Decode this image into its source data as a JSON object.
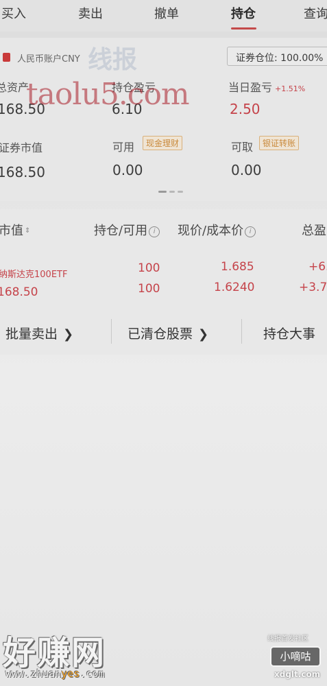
{
  "tabs": [
    {
      "label": "买入"
    },
    {
      "label": "卖出"
    },
    {
      "label": "撤单"
    },
    {
      "label": "持仓"
    },
    {
      "label": "查询"
    }
  ],
  "active_tab": "持仓",
  "account": {
    "label": "人民币账户CNY",
    "position_ratio": "证券仓位: 100.00%"
  },
  "summary": {
    "total_assets_label": "总资产",
    "total_assets_value": "168.50",
    "holding_pnl_label": "持仓盈亏",
    "holding_pnl_value": "6.10",
    "daily_pnl_label": "当日盈亏",
    "daily_pnl_pct": "+1.51%",
    "daily_pnl_value": "2.50",
    "market_value_label": "证券市值",
    "market_value_value": "168.50",
    "available_label": "可用",
    "available_pill": "现金理财",
    "available_value": "0.00",
    "withdrawable_label": "可取",
    "withdrawable_pill": "银证转账",
    "withdrawable_value": "0.00"
  },
  "holdings": {
    "columns": [
      "市值",
      "持仓/可用",
      "现价/成本价",
      "总盈"
    ],
    "rows": [
      {
        "name": "纳斯达克100ETF",
        "market_value": "168.50",
        "position": "100",
        "available": "100",
        "price": "1.685",
        "cost": "1.6240",
        "total_pnl": "+6.",
        "total_pnl_pct": "+3.7"
      }
    ]
  },
  "actions": {
    "batch_sell": "批量卖出",
    "cleared_stocks": "已清仓股票",
    "holding_events": "持仓大事"
  },
  "watermarks": {
    "taolu": "taolu5.com",
    "faint": "线报",
    "site_big": "好赚网",
    "site_url_a": "www.zhuan",
    "site_url_b": "yes",
    "site_url_c": ".com",
    "community": "线报首发社区",
    "brand": "小嘀咕",
    "brand_url": "xdglt.com"
  },
  "colors": {
    "accent_red": "#c5434a",
    "pill_orange": "#c98a3c"
  }
}
